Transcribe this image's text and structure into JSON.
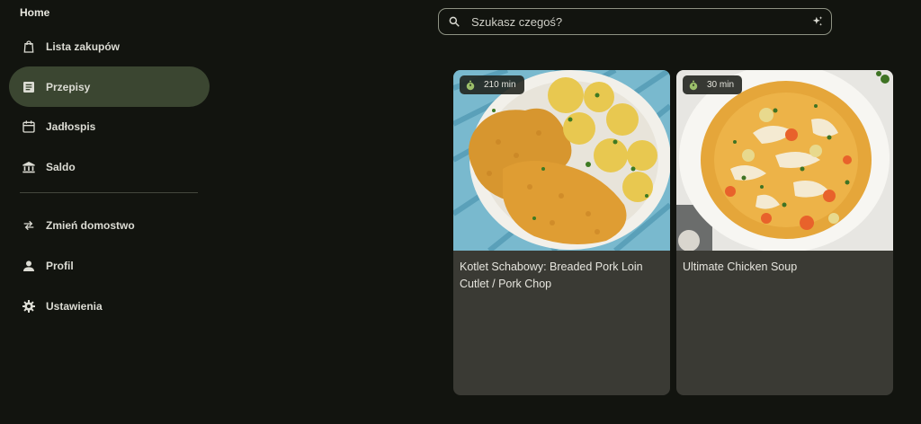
{
  "sidebar": {
    "title": "Home",
    "items": [
      {
        "label": "Lista zakupów",
        "icon": "shopping-bag-icon"
      },
      {
        "label": "Przepisy",
        "icon": "recipe-list-icon",
        "active": true
      },
      {
        "label": "Jadłospis",
        "icon": "calendar-icon"
      },
      {
        "label": "Saldo",
        "icon": "bank-icon"
      }
    ],
    "secondary_items": [
      {
        "label": "Zmień domostwo",
        "icon": "swap-arrows-icon"
      },
      {
        "label": "Profil",
        "icon": "person-icon"
      },
      {
        "label": "Ustawienia",
        "icon": "gear-icon"
      }
    ]
  },
  "search": {
    "placeholder": "Szukasz czegoś?",
    "icon": "search-icon",
    "action_icon": "sparkle-icon"
  },
  "recipes": [
    {
      "time": "210 min",
      "title": "Kotlet Schabowy: Breaded Pork Loin Cutlet / Pork Chop",
      "image": "pork-cutlet-with-potatoes"
    },
    {
      "time": "30 min",
      "title": "Ultimate Chicken Soup",
      "image": "chicken-soup-bowl"
    }
  ],
  "colors": {
    "background": "#12140f",
    "active_nav": "#3b4631",
    "card": "#3a3a34",
    "badge_icon": "#9bbf6a"
  }
}
